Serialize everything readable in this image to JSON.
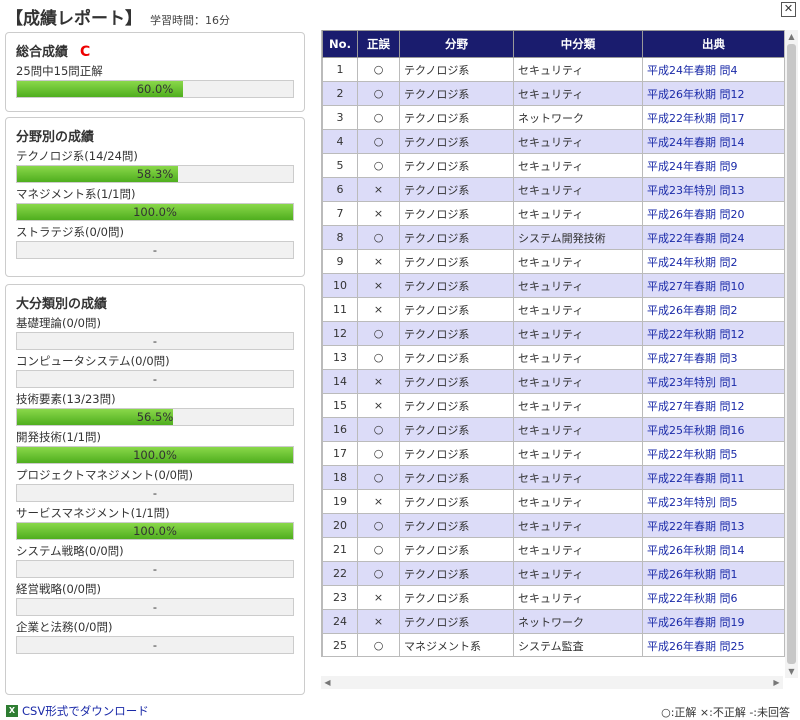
{
  "header": {
    "title": "【成績レポート】",
    "study_time": "学習時間：16分",
    "close": "✕"
  },
  "overall": {
    "title": "総合成績",
    "grade": "C",
    "summary": "25問中15問正解",
    "percent": 60.0,
    "bar_text": "60.0%"
  },
  "field": {
    "title": "分野別の成績",
    "items": [
      {
        "label": "テクノロジ系(14/24問)",
        "percent": 58.3,
        "bar_text": "58.3%"
      },
      {
        "label": "マネジメント系(1/1問)",
        "percent": 100.0,
        "bar_text": "100.0%"
      },
      {
        "label": "ストラテジ系(0/0問)",
        "percent": 0,
        "bar_text": "-"
      }
    ]
  },
  "category": {
    "title": "大分類別の成績",
    "items": [
      {
        "label": "基礎理論(0/0問)",
        "percent": 0,
        "bar_text": "-"
      },
      {
        "label": "コンピュータシステム(0/0問)",
        "percent": 0,
        "bar_text": "-"
      },
      {
        "label": "技術要素(13/23問)",
        "percent": 56.5,
        "bar_text": "56.5%"
      },
      {
        "label": "開発技術(1/1問)",
        "percent": 100.0,
        "bar_text": "100.0%"
      },
      {
        "label": "プロジェクトマネジメント(0/0問)",
        "percent": 0,
        "bar_text": "-"
      },
      {
        "label": "サービスマネジメント(1/1問)",
        "percent": 100.0,
        "bar_text": "100.0%"
      },
      {
        "label": "システム戦略(0/0問)",
        "percent": 0,
        "bar_text": "-"
      },
      {
        "label": "経営戦略(0/0問)",
        "percent": 0,
        "bar_text": "-"
      },
      {
        "label": "企業と法務(0/0問)",
        "percent": 0,
        "bar_text": "-"
      }
    ]
  },
  "table": {
    "headers": [
      "No.",
      "正誤",
      "分野",
      "中分類",
      "出典"
    ],
    "rows": [
      [
        "1",
        "○",
        "テクノロジ系",
        "セキュリティ",
        "平成24年春期 問4"
      ],
      [
        "2",
        "○",
        "テクノロジ系",
        "セキュリティ",
        "平成26年秋期 問12"
      ],
      [
        "3",
        "○",
        "テクノロジ系",
        "ネットワーク",
        "平成22年秋期 問17"
      ],
      [
        "4",
        "○",
        "テクノロジ系",
        "セキュリティ",
        "平成24年春期 問14"
      ],
      [
        "5",
        "○",
        "テクノロジ系",
        "セキュリティ",
        "平成24年春期 問9"
      ],
      [
        "6",
        "×",
        "テクノロジ系",
        "セキュリティ",
        "平成23年特別 問13"
      ],
      [
        "7",
        "×",
        "テクノロジ系",
        "セキュリティ",
        "平成26年春期 問20"
      ],
      [
        "8",
        "○",
        "テクノロジ系",
        "システム開発技術",
        "平成22年春期 問24"
      ],
      [
        "9",
        "×",
        "テクノロジ系",
        "セキュリティ",
        "平成24年秋期 問2"
      ],
      [
        "10",
        "×",
        "テクノロジ系",
        "セキュリティ",
        "平成27年春期 問10"
      ],
      [
        "11",
        "×",
        "テクノロジ系",
        "セキュリティ",
        "平成26年春期 問2"
      ],
      [
        "12",
        "○",
        "テクノロジ系",
        "セキュリティ",
        "平成22年秋期 問12"
      ],
      [
        "13",
        "○",
        "テクノロジ系",
        "セキュリティ",
        "平成27年春期 問3"
      ],
      [
        "14",
        "×",
        "テクノロジ系",
        "セキュリティ",
        "平成23年特別 問1"
      ],
      [
        "15",
        "×",
        "テクノロジ系",
        "セキュリティ",
        "平成27年春期 問12"
      ],
      [
        "16",
        "○",
        "テクノロジ系",
        "セキュリティ",
        "平成25年秋期 問16"
      ],
      [
        "17",
        "○",
        "テクノロジ系",
        "セキュリティ",
        "平成22年秋期 問5"
      ],
      [
        "18",
        "○",
        "テクノロジ系",
        "セキュリティ",
        "平成22年春期 問11"
      ],
      [
        "19",
        "×",
        "テクノロジ系",
        "セキュリティ",
        "平成23年特別 問5"
      ],
      [
        "20",
        "○",
        "テクノロジ系",
        "セキュリティ",
        "平成22年春期 問13"
      ],
      [
        "21",
        "○",
        "テクノロジ系",
        "セキュリティ",
        "平成26年秋期 問14"
      ],
      [
        "22",
        "○",
        "テクノロジ系",
        "セキュリティ",
        "平成26年秋期 問1"
      ],
      [
        "23",
        "×",
        "テクノロジ系",
        "セキュリティ",
        "平成22年秋期 問6"
      ],
      [
        "24",
        "×",
        "テクノロジ系",
        "ネットワーク",
        "平成26年春期 問19"
      ],
      [
        "25",
        "○",
        "マネジメント系",
        "システム監査",
        "平成26年春期 問25"
      ]
    ]
  },
  "footer": {
    "csv_label": "CSV形式でダウンロード",
    "legend": "○:正解 ×:不正解 -:未回答"
  },
  "colors": {
    "header_bg": "#1a1c6e",
    "row_alt": "#dcdcf8",
    "bar_fill": "#5cbc28",
    "grade": "#e00000",
    "link": "#1a2aa8"
  }
}
